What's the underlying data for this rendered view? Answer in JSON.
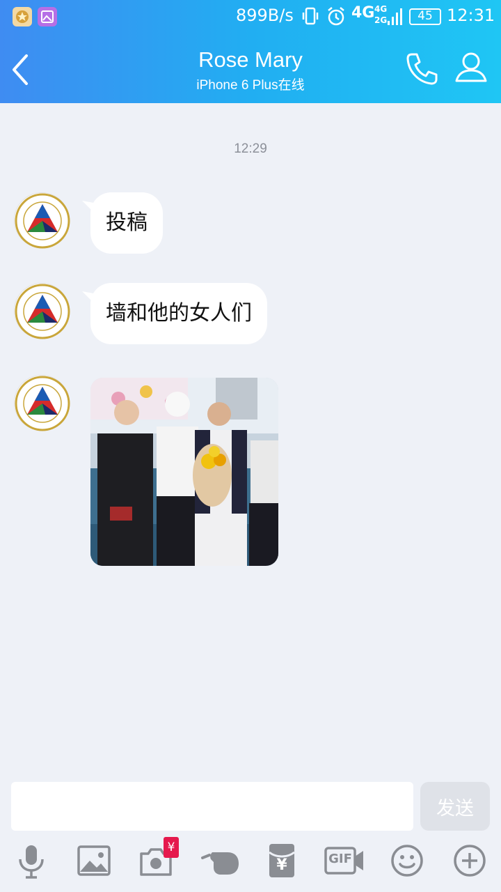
{
  "status_bar": {
    "speed": "899B/s",
    "net_4g": "4G",
    "net_4g_small": "4G",
    "net_2g_small": "2G",
    "battery": "45",
    "time": "12:31"
  },
  "header": {
    "title": "Rose Mary",
    "subtitle": "iPhone 6 Plus在线"
  },
  "chat": {
    "timestamp": "12:29",
    "messages": [
      {
        "type": "text",
        "text": "投稿"
      },
      {
        "type": "text",
        "text": "墙和他的女人们"
      },
      {
        "type": "image"
      }
    ]
  },
  "input": {
    "value": "",
    "send_label": "发送"
  },
  "toolbar": {
    "icons": [
      "microphone-icon",
      "image-icon",
      "camera-icon",
      "poke-icon",
      "red-envelope-icon",
      "gif-icon",
      "emoji-icon",
      "plus-icon"
    ],
    "gif_label": "GIF",
    "camera_badge": "¥",
    "envelope_label": "¥"
  },
  "colors": {
    "header_gradient_start": "#3f8cf2",
    "header_gradient_end": "#1fc6f4",
    "chat_background": "#eef1f7",
    "bubble": "#ffffff",
    "icon_gray": "#8a8d93",
    "red_badge": "#e5194d"
  }
}
